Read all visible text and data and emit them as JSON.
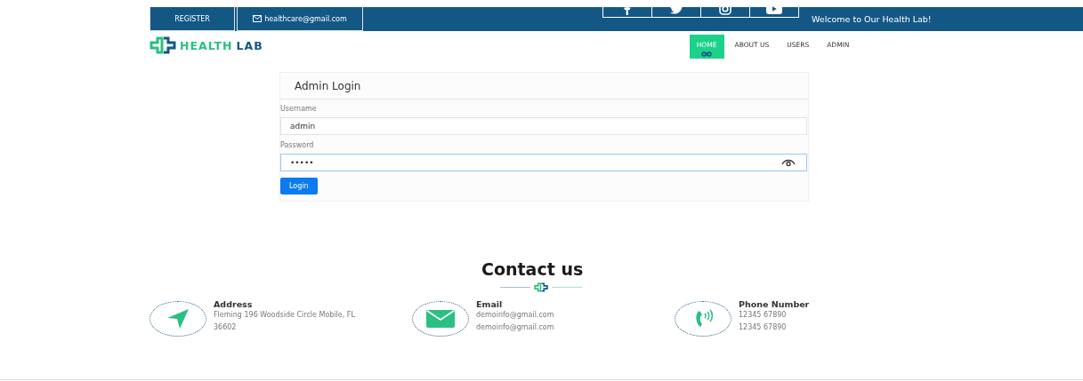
{
  "topbar": {
    "register": "REGISTER",
    "email": "healthcare@gmail.com",
    "welcome": "Welcome to Our Health Lab!"
  },
  "social": [
    {
      "kind": "facebook"
    },
    {
      "kind": "twitter"
    },
    {
      "kind": "instagram"
    },
    {
      "kind": "youtube"
    }
  ],
  "logo": {
    "part1": "HEALTH",
    "part2": "LAB"
  },
  "nav": [
    {
      "label": "HOME",
      "selected": true
    },
    {
      "label": "ABOUT US",
      "selected": false
    },
    {
      "label": "USERS",
      "selected": false
    },
    {
      "label": "ADMIN",
      "selected": false
    }
  ],
  "login": {
    "title": "Admin Login",
    "username_label": "Username",
    "username": "admin",
    "password_label": "Password",
    "password": "•••••",
    "button": "Login"
  },
  "contact": {
    "title": "Contact us",
    "items": [
      {
        "kind": "address",
        "title": "Address",
        "lines": [
          "Fleming 196 Woodside Circle Mobile, FL",
          "36602"
        ]
      },
      {
        "kind": "email",
        "title": "Email",
        "lines": [
          "demoinfo@gmail.com",
          "demoinfo@gmail.com"
        ]
      },
      {
        "kind": "phone",
        "title": "Phone Number",
        "lines": [
          "12345 67890",
          "12345 67890"
        ]
      }
    ]
  }
}
